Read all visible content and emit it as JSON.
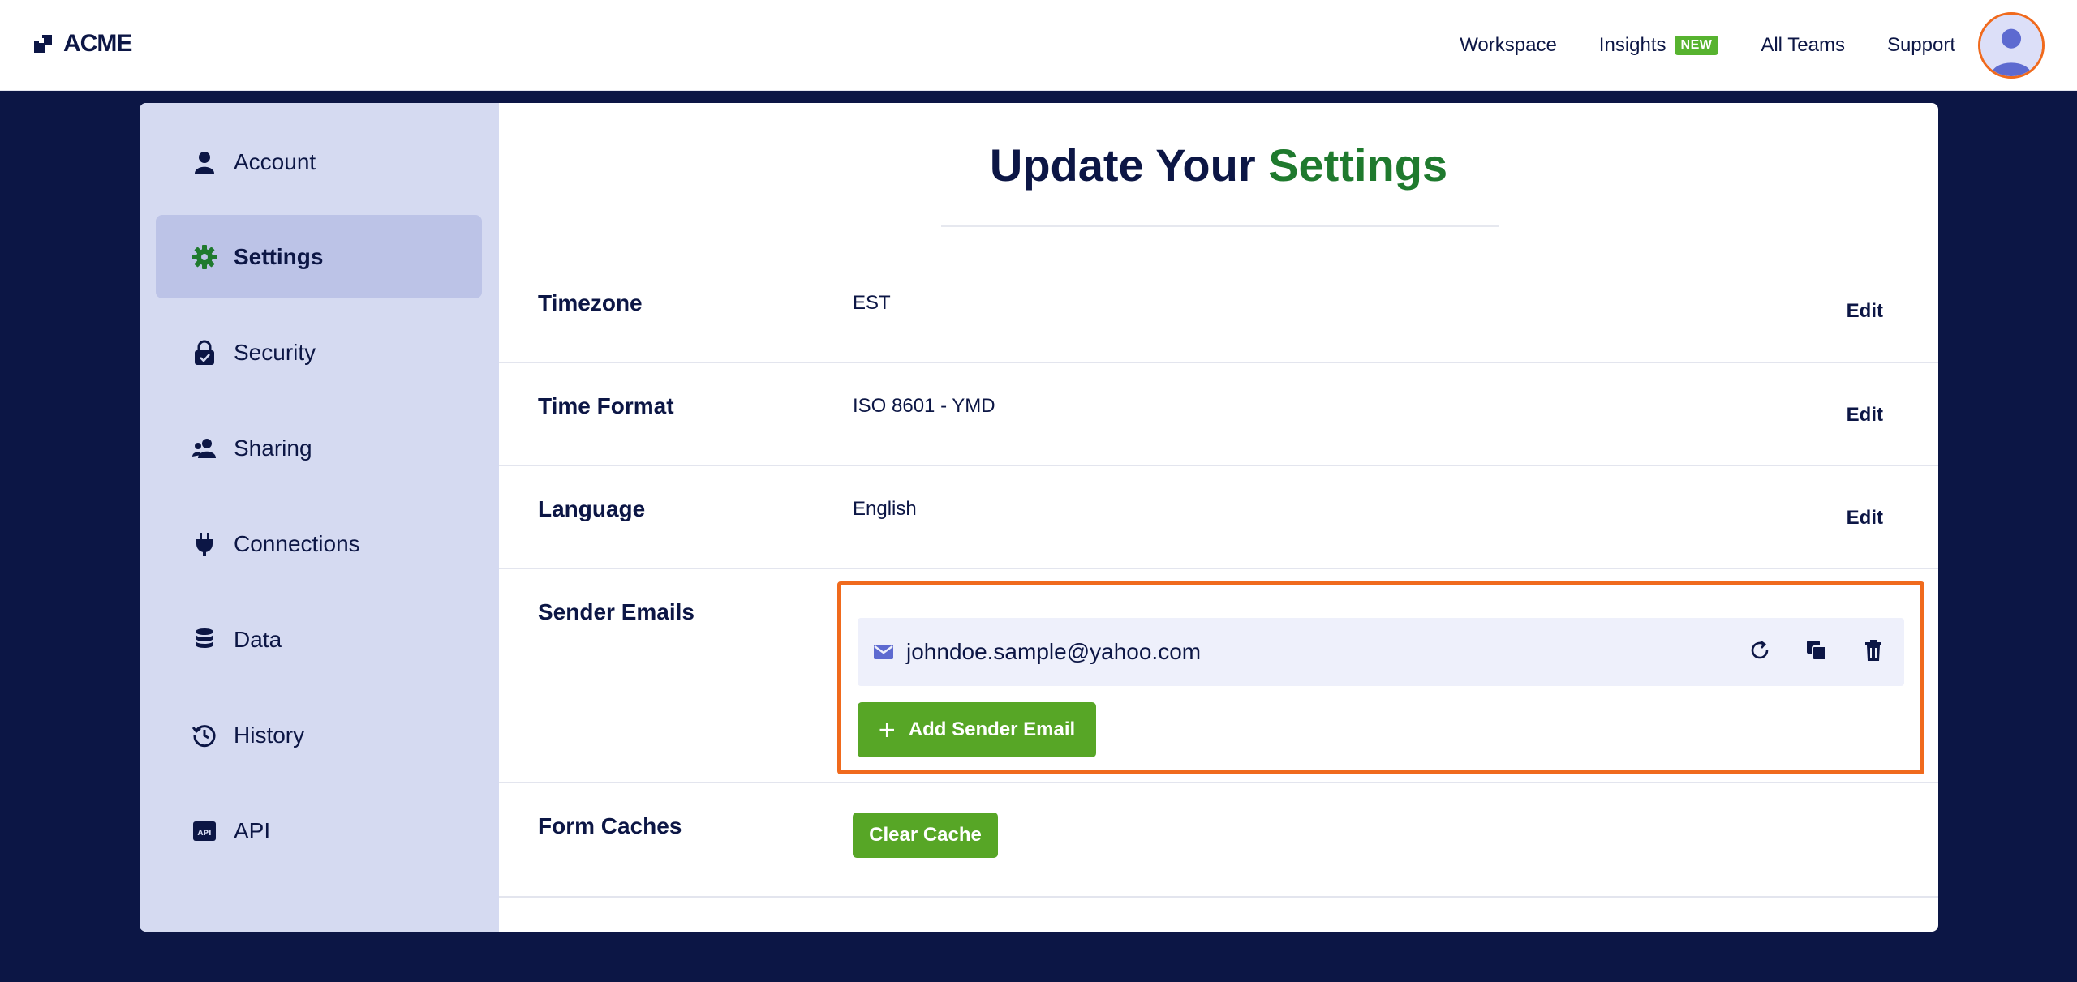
{
  "header": {
    "logo_text": "ACME",
    "nav": [
      {
        "label": "Workspace"
      },
      {
        "label": "Insights",
        "badge": "NEW"
      },
      {
        "label": "All Teams"
      },
      {
        "label": "Support"
      }
    ]
  },
  "sidebar": {
    "items": [
      {
        "label": "Account",
        "icon": "user-icon",
        "active": false
      },
      {
        "label": "Settings",
        "icon": "gear-icon",
        "active": true
      },
      {
        "label": "Security",
        "icon": "lock-icon",
        "active": false
      },
      {
        "label": "Sharing",
        "icon": "people-icon",
        "active": false
      },
      {
        "label": "Connections",
        "icon": "plug-icon",
        "active": false
      },
      {
        "label": "Data",
        "icon": "database-icon",
        "active": false
      },
      {
        "label": "History",
        "icon": "history-icon",
        "active": false
      },
      {
        "label": "API",
        "icon": "api-icon",
        "active": false
      }
    ]
  },
  "main": {
    "title_part1": "Update Your",
    "title_part2": "Settings",
    "settings": [
      {
        "label": "Timezone",
        "value": "EST",
        "action": "Edit"
      },
      {
        "label": "Time Format",
        "value": "ISO 8601 - YMD",
        "action": "Edit"
      },
      {
        "label": "Language",
        "value": "English",
        "action": "Edit"
      }
    ],
    "sender_emails": {
      "label": "Sender Emails",
      "emails": [
        "johndoe.sample@yahoo.com"
      ],
      "add_button": "Add Sender Email"
    },
    "form_caches": {
      "label": "Form Caches",
      "button": "Clear Cache"
    }
  },
  "colors": {
    "navy": "#0c1645",
    "green_accent": "#1f7a2e",
    "button_green": "#57a626",
    "highlight_orange": "#f06a1d",
    "sidebar_bg": "#d5daf1",
    "sidebar_active": "#bcc3e7"
  }
}
